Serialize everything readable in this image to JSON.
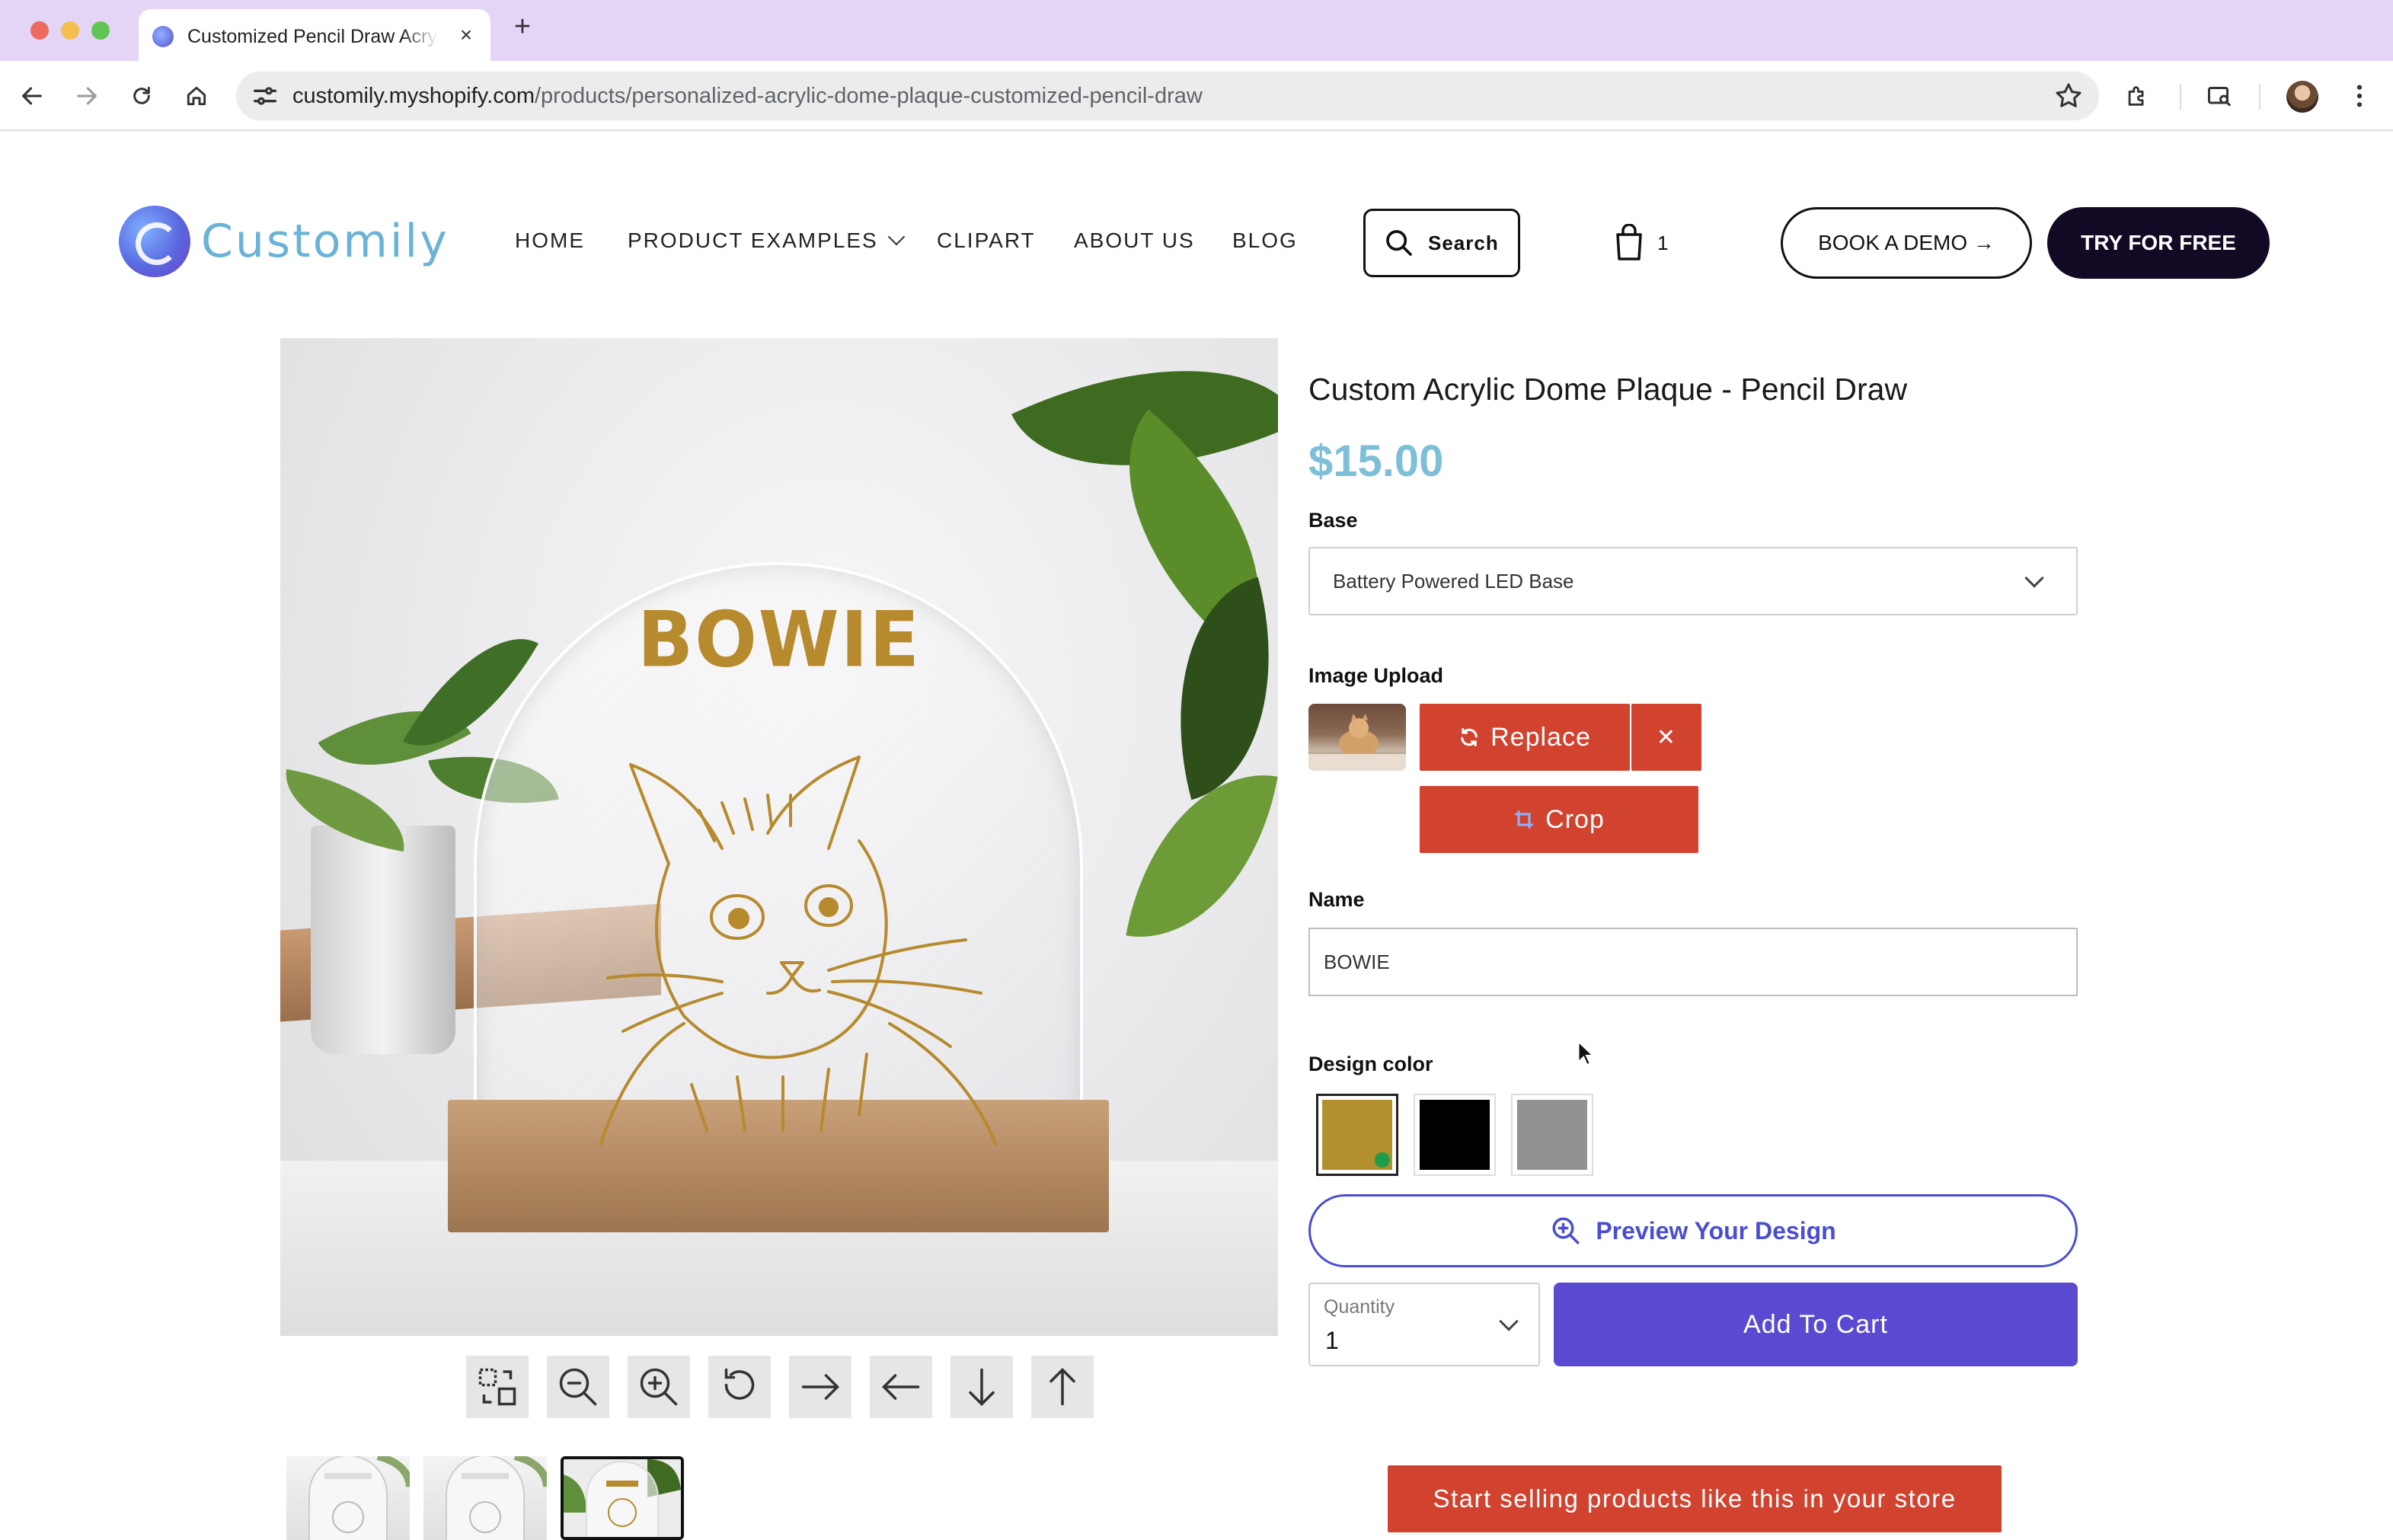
{
  "browser": {
    "tab_title": "Customized Pencil Draw Acrylic Dome Plaque",
    "url_host": "customily.myshopify.com",
    "url_path": "/products/personalized-acrylic-dome-plaque-customized-pencil-draw"
  },
  "header": {
    "logo_text": "Customily",
    "nav": [
      {
        "label": "HOME"
      },
      {
        "label": "PRODUCT EXAMPLES"
      },
      {
        "label": "CLIPART"
      },
      {
        "label": "ABOUT US"
      },
      {
        "label": "BLOG"
      }
    ],
    "search_label": "Search",
    "cart_count": "1",
    "book_demo_label": "BOOK A DEMO →",
    "try_free_label": "TRY FOR FREE"
  },
  "hero": {
    "engraved_name": "BOWIE",
    "toolbar_icons": [
      "select-toggle-icon",
      "zoom-out-icon",
      "zoom-in-icon",
      "rotate-icon",
      "arrow-right-icon",
      "arrow-left-icon",
      "arrow-down-icon",
      "arrow-up-icon"
    ],
    "thumbnails_count": 3,
    "selected_thumbnail": 3
  },
  "product": {
    "title": "Custom Acrylic Dome Plaque - Pencil Draw",
    "price": "$15.00",
    "base_label": "Base",
    "base_value": "Battery Powered LED Base",
    "image_upload_label": "Image Upload",
    "replace_label": "Replace",
    "remove_label": "✕",
    "crop_label": "Crop",
    "name_label": "Name",
    "name_value": "BOWIE",
    "design_color_label": "Design color",
    "colors": [
      {
        "name": "gold",
        "hex": "#b3902f",
        "selected": true
      },
      {
        "name": "black",
        "hex": "#000000",
        "selected": false
      },
      {
        "name": "gray",
        "hex": "#929292",
        "selected": false
      }
    ],
    "preview_label": "Preview Your Design",
    "quantity_label": "Quantity",
    "quantity_value": "1",
    "add_to_cart_label": "Add To Cart",
    "sell_label": "Start selling products like this in your store"
  },
  "colors": {
    "accent_red": "#d2432f",
    "accent_purple": "#5a4ad1",
    "price_blue": "#7cbfd7",
    "tab_bar": "#e4d5f7"
  }
}
